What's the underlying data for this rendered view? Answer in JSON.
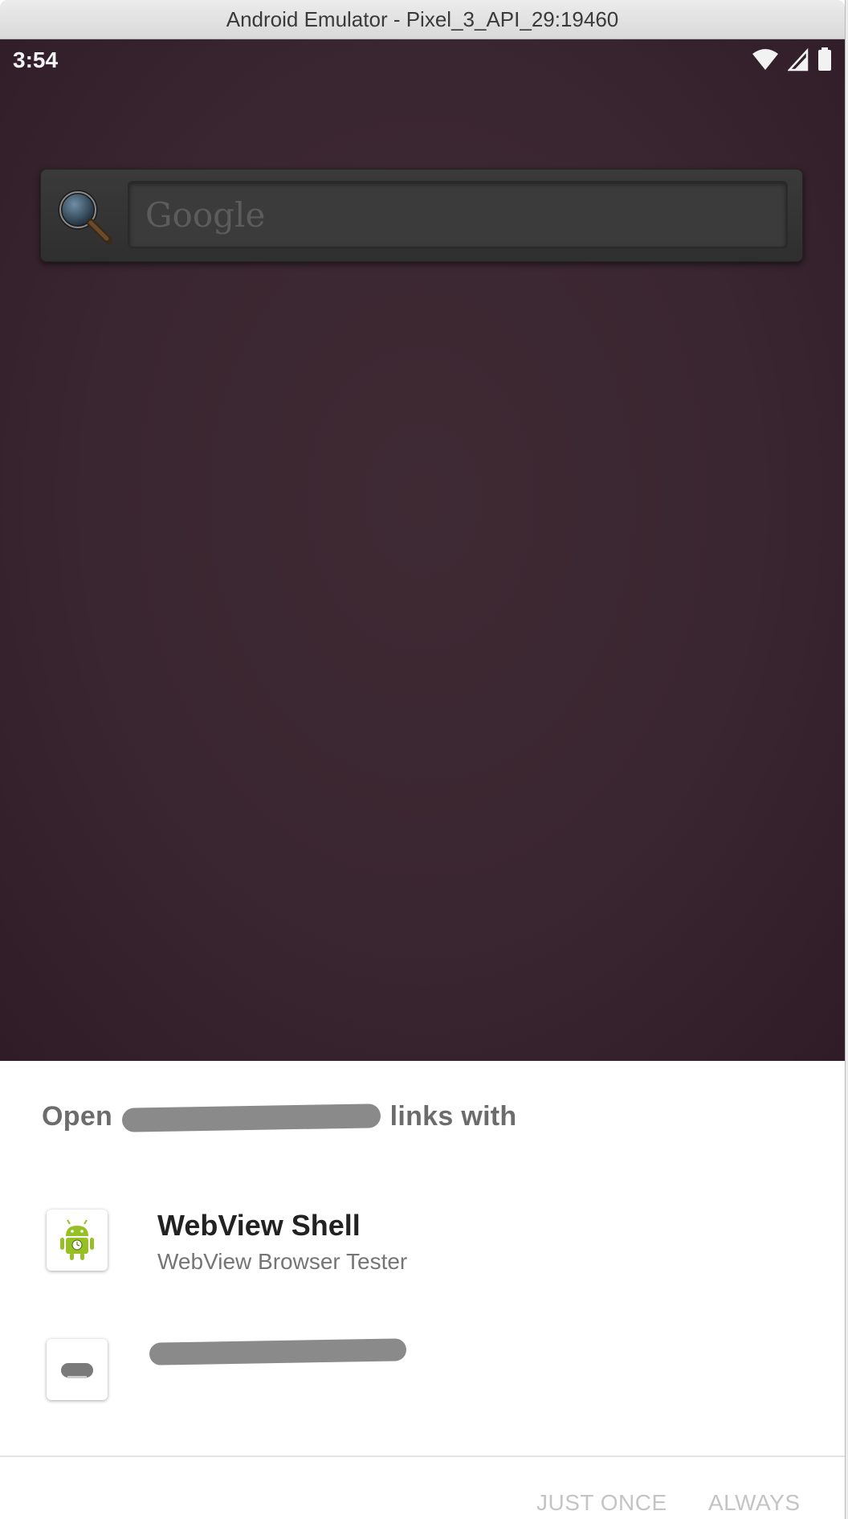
{
  "window": {
    "title": "Android Emulator - Pixel_3_API_29:19460"
  },
  "statusbar": {
    "time": "3:54",
    "icons": [
      "wifi-icon",
      "cell-signal-icon",
      "battery-icon"
    ]
  },
  "search_widget": {
    "placeholder": "Google",
    "icon": "magnifier-icon"
  },
  "dialog": {
    "title_prefix": "Open",
    "title_suffix": "links with",
    "apps": [
      {
        "name": "WebView Shell",
        "subtitle": "WebView Browser Tester",
        "icon": "android-robot-icon"
      },
      {
        "name": "",
        "subtitle": "",
        "icon": "app-icon-redacted"
      }
    ],
    "buttons": {
      "just_once": "JUST ONCE",
      "always": "ALWAYS"
    }
  },
  "colors": {
    "wallpaper": "#3a2630",
    "button_disabled": "#c4c4c4",
    "android_green": "#97c024"
  }
}
